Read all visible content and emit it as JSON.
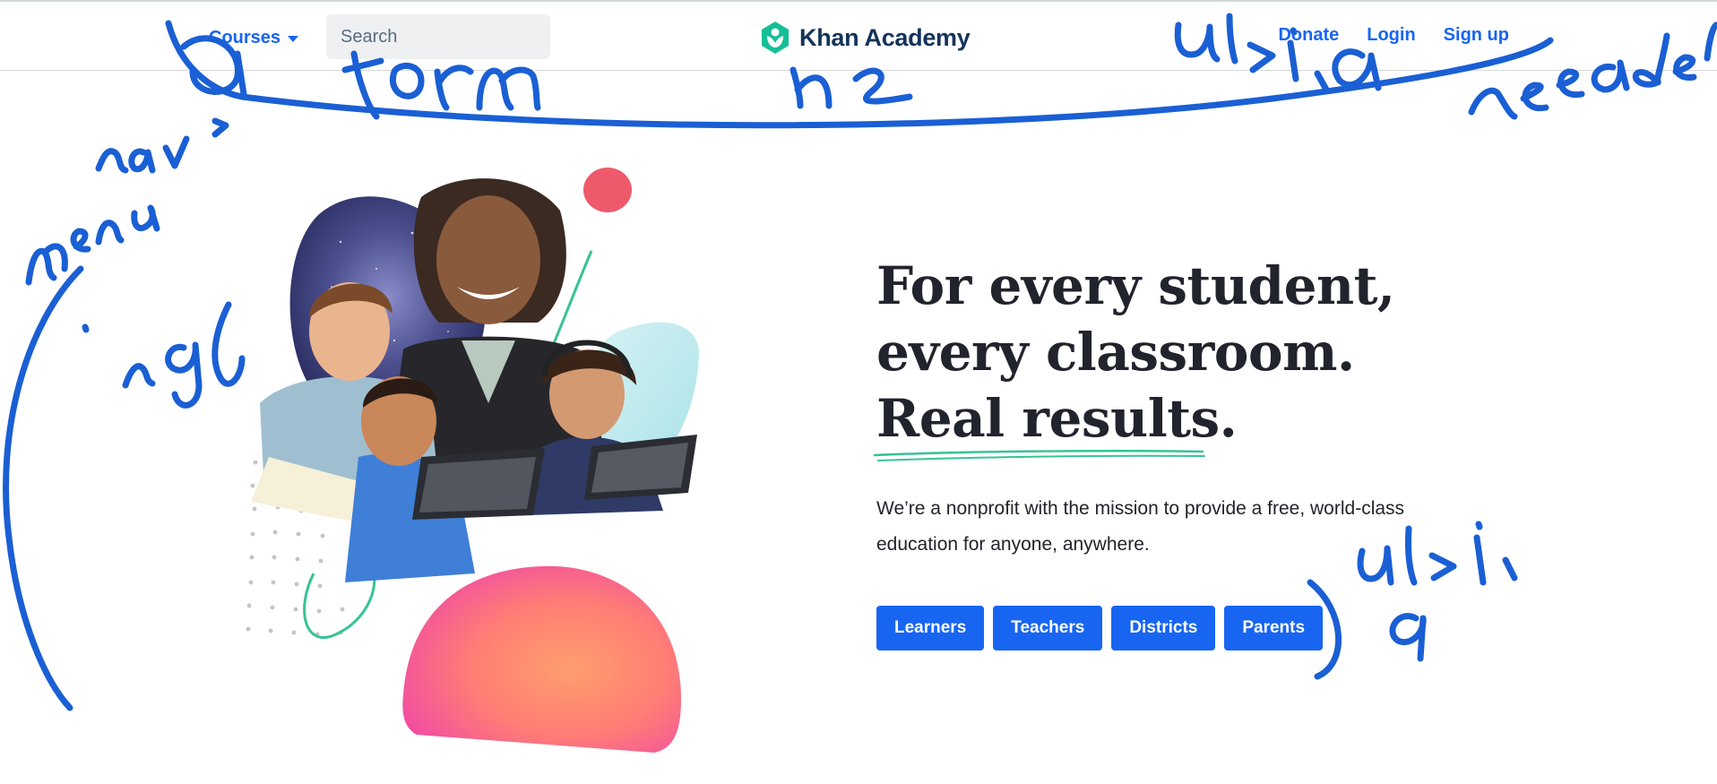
{
  "header": {
    "courses_label": "Courses",
    "search_placeholder": "Search",
    "logo_text": "Khan Academy",
    "nav_links": [
      "Donate",
      "Login",
      "Sign up"
    ]
  },
  "hero": {
    "title_lines": [
      "For every student,",
      "every classroom.",
      "Real results."
    ],
    "subtitle": "We’re a nonprofit with the mission to provide a free, world-class education for anyone, anywhere.",
    "buttons": [
      "Learners",
      "Teachers",
      "Districts",
      "Parents"
    ]
  },
  "colors": {
    "brand_blue": "#1865f2",
    "logo_green": "#14bf96",
    "logo_text": "#14335a",
    "ink_blue": "#1a5fd4",
    "underline_green": "#35c492"
  },
  "icons": [
    "chevron-down-icon",
    "search-icon",
    "khan-academy-logo-icon"
  ]
}
